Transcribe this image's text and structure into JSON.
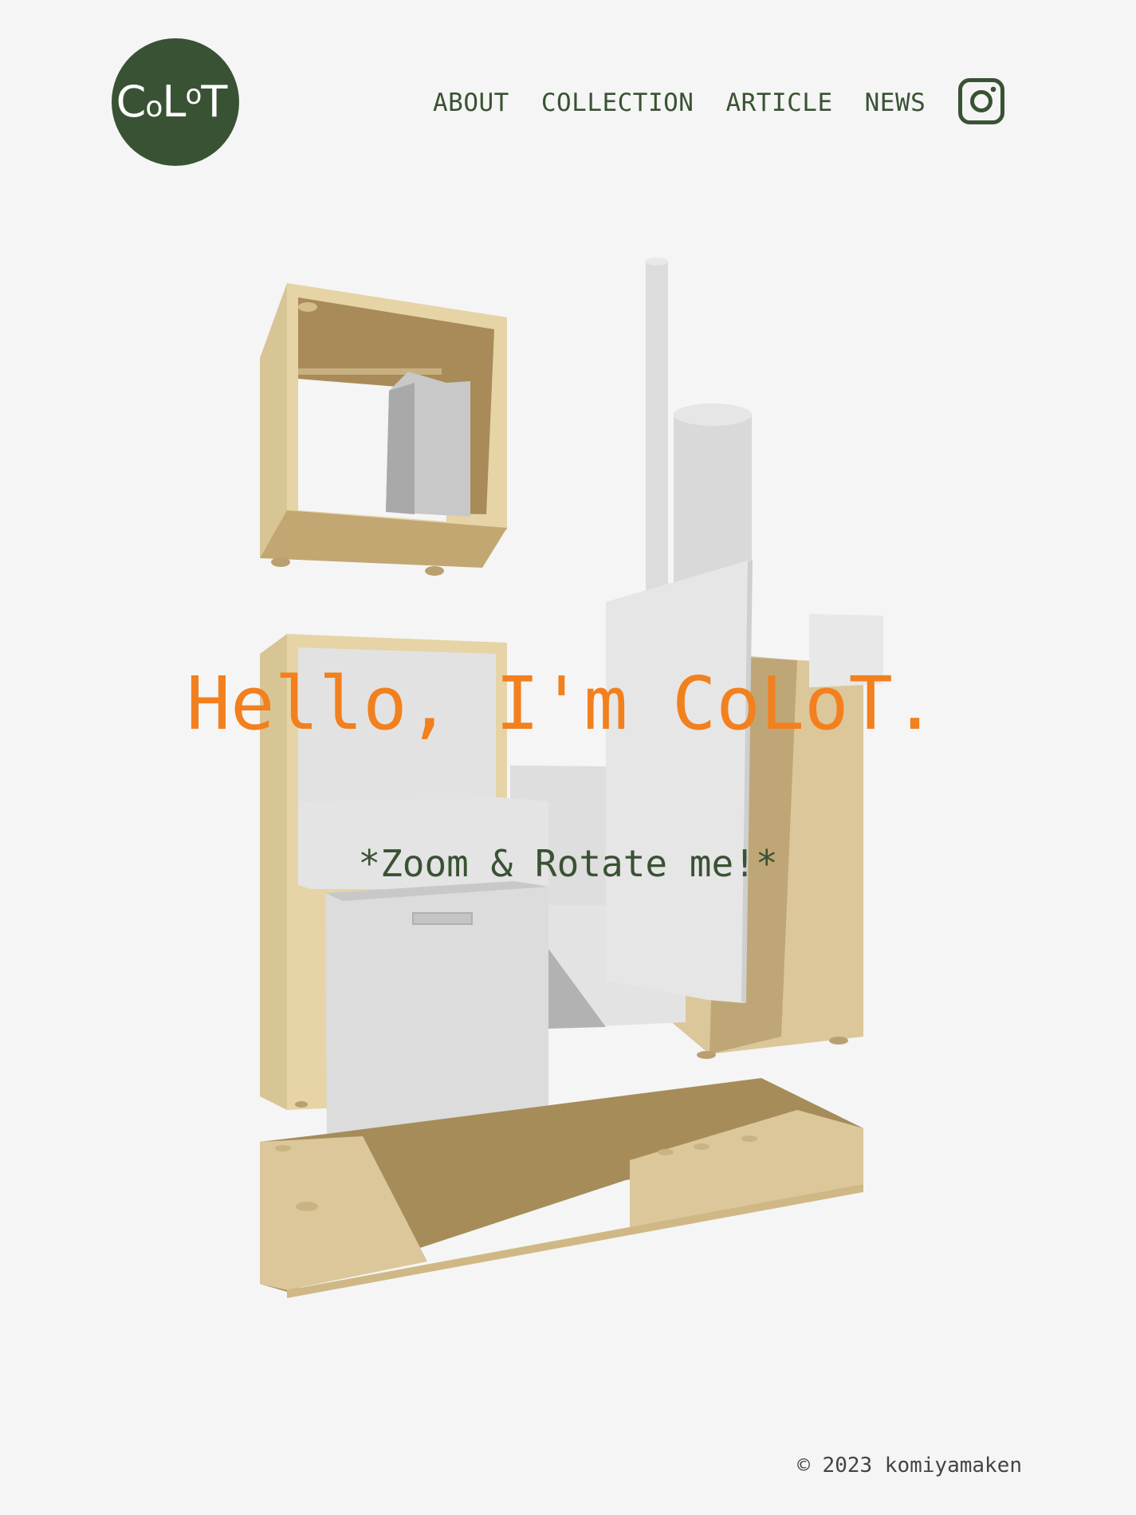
{
  "header": {
    "logo": {
      "main": "C",
      "small_o": "o",
      "L": "L",
      "sup_o": "o",
      "T": "T",
      "fill": "#3a5234"
    },
    "nav": [
      {
        "label": "ABOUT"
      },
      {
        "label": "COLLECTION"
      },
      {
        "label": "ARTICLE"
      },
      {
        "label": "NEWS"
      }
    ],
    "social_icon": "instagram-icon"
  },
  "hero": {
    "title": "Hello, I'm CoLoT.",
    "subtitle": "*Zoom & Rotate me!*",
    "title_color": "#f2801e",
    "subtitle_color": "#3a5234"
  },
  "footer": {
    "copyright": "© 2023 komiyamaken"
  },
  "colors": {
    "background": "#f5f5f5",
    "wood_light": "#dcc79b",
    "wood_dark": "#a88c5a",
    "panel_white": "#e0e0e0",
    "panel_shadow": "#b3b3b3"
  }
}
